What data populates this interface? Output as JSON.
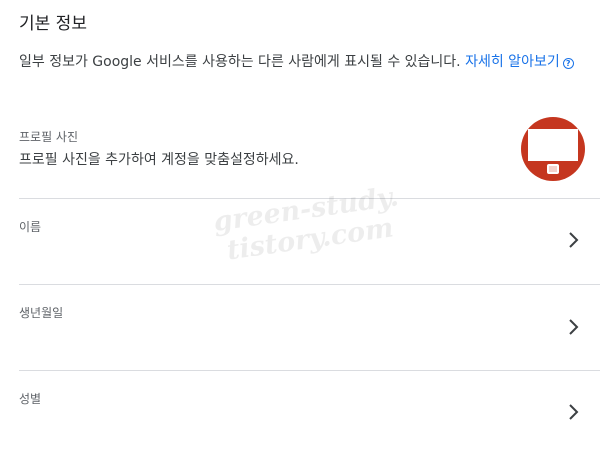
{
  "section": {
    "title": "기본 정보",
    "description": "일부 정보가 Google 서비스를 사용하는 다른 사람에게 표시될 수 있습니다.",
    "learn_more": "자세히 알아보기",
    "help_icon": "?"
  },
  "profile_photo": {
    "label": "프로필 사진",
    "description": "프로필 사진을 추가하여 계정을 맞춤설정하세요.",
    "avatar_icon": "monitor-avatar-icon"
  },
  "rows": [
    {
      "label": "이름"
    },
    {
      "label": "생년월일"
    },
    {
      "label": "성별"
    }
  ],
  "watermark": {
    "line1": "green-study.",
    "line2": "tistory.com"
  },
  "colors": {
    "link": "#1a73e8",
    "divider": "#dadce0",
    "avatar_bg": "#c5361f"
  }
}
